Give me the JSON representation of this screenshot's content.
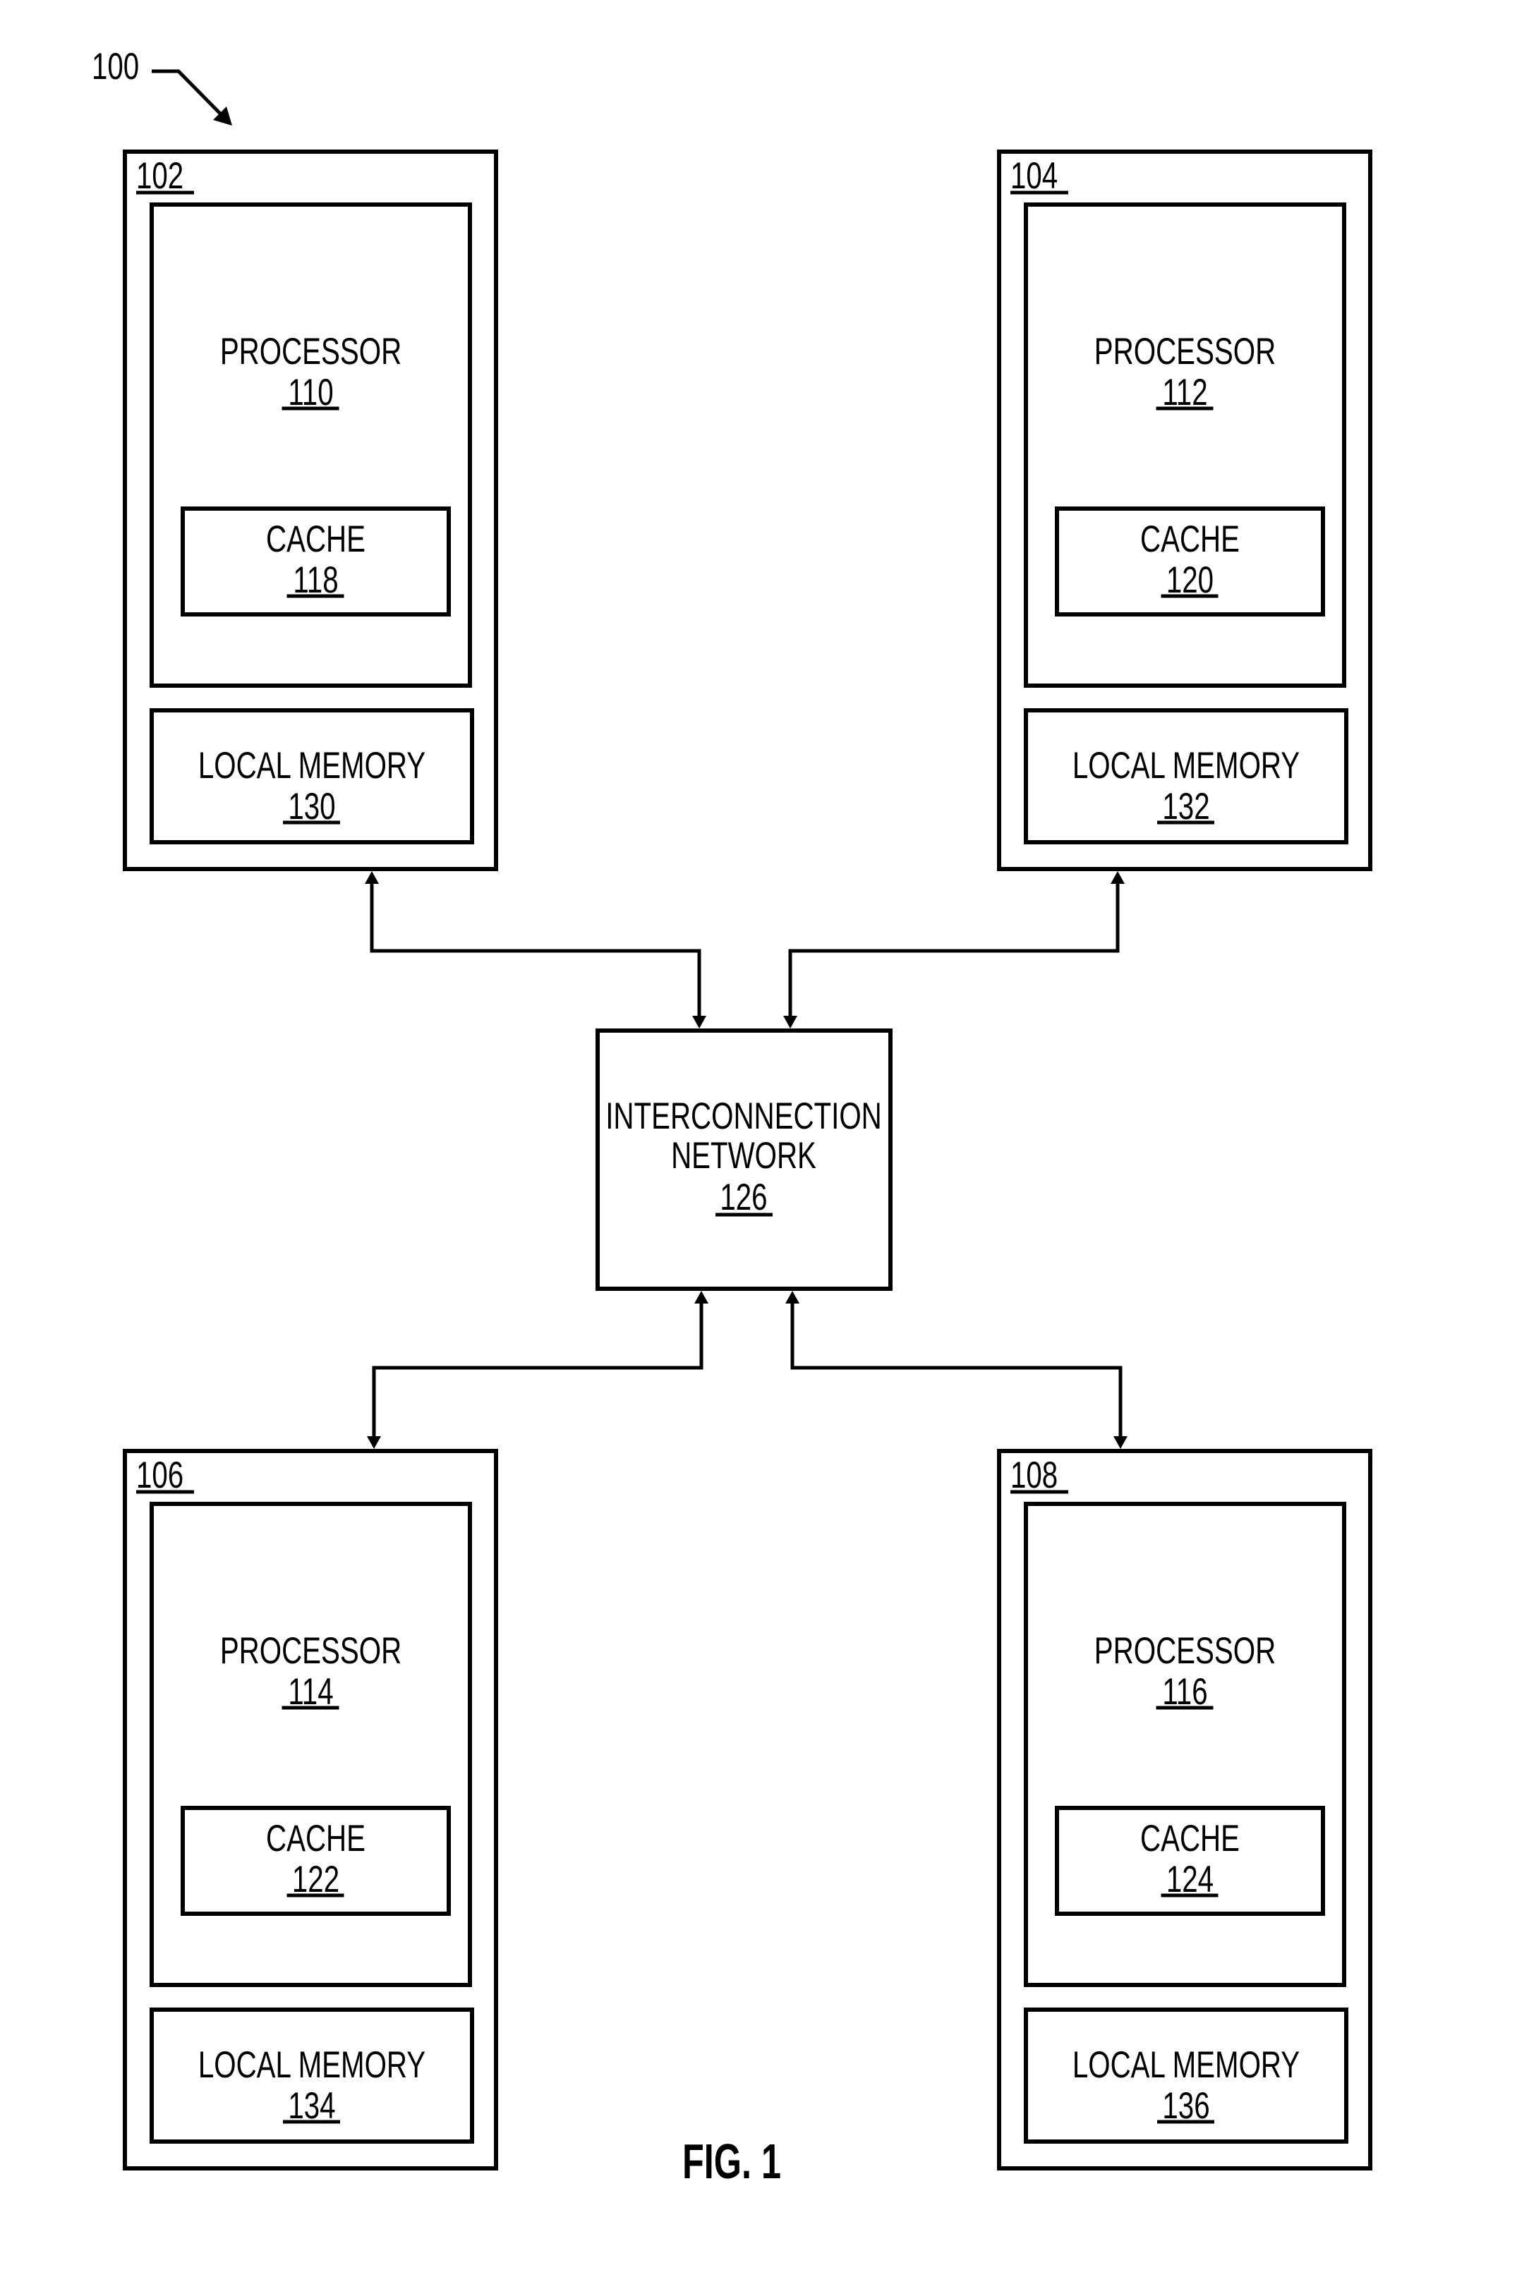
{
  "figure": {
    "reference": "100",
    "caption": "FIG. 1"
  },
  "nodes": [
    {
      "id": "102",
      "processor": {
        "label": "PROCESSOR",
        "ref": "110"
      },
      "cache": {
        "label": "CACHE",
        "ref": "118"
      },
      "memory": {
        "label": "LOCAL MEMORY",
        "ref": "130"
      }
    },
    {
      "id": "104",
      "processor": {
        "label": "PROCESSOR",
        "ref": "112"
      },
      "cache": {
        "label": "CACHE",
        "ref": "120"
      },
      "memory": {
        "label": "LOCAL MEMORY",
        "ref": "132"
      }
    },
    {
      "id": "106",
      "processor": {
        "label": "PROCESSOR",
        "ref": "114"
      },
      "cache": {
        "label": "CACHE",
        "ref": "122"
      },
      "memory": {
        "label": "LOCAL MEMORY",
        "ref": "134"
      }
    },
    {
      "id": "108",
      "processor": {
        "label": "PROCESSOR",
        "ref": "116"
      },
      "cache": {
        "label": "CACHE",
        "ref": "124"
      },
      "memory": {
        "label": "LOCAL MEMORY",
        "ref": "136"
      }
    }
  ],
  "network": {
    "line1": "INTERCONNECTION",
    "line2": "NETWORK",
    "ref": "126"
  },
  "connections": [
    {
      "from": "102",
      "to": "126",
      "bidirectional": true
    },
    {
      "from": "104",
      "to": "126",
      "bidirectional": true
    },
    {
      "from": "106",
      "to": "126",
      "bidirectional": true
    },
    {
      "from": "108",
      "to": "126",
      "bidirectional": true
    }
  ]
}
